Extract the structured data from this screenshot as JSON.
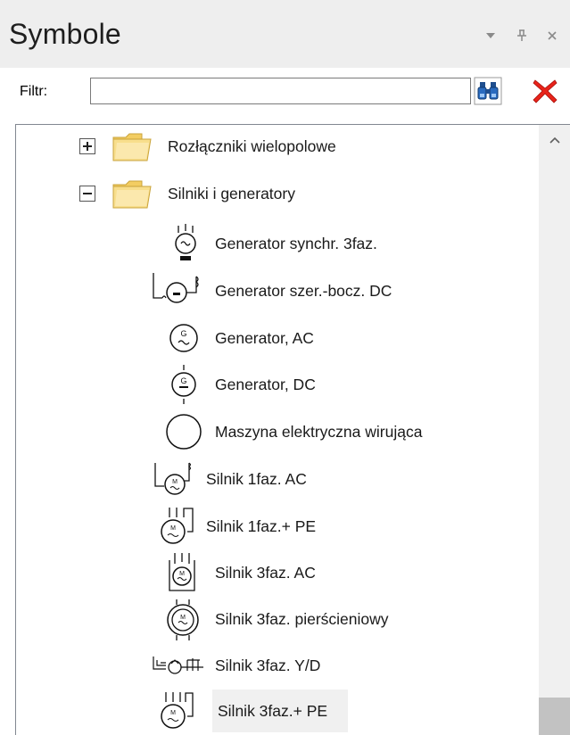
{
  "panel": {
    "title": "Symbole",
    "dropdown_icon": "▼",
    "pin_icon": "ᛰ",
    "close_icon": "×"
  },
  "filter": {
    "label": "Filtr:",
    "value": "",
    "placeholder": "",
    "search_icon": "binoculars-icon",
    "clear_icon": "red-x-icon"
  },
  "tree": {
    "folders": [
      {
        "label": "Rozłączniki wielopolowe",
        "expanded": false
      },
      {
        "label": "Silniki i generatory",
        "expanded": true
      }
    ],
    "items": [
      {
        "label": "Generator synchr. 3faz.",
        "icon": "generator-synchronous-icon"
      },
      {
        "label": "Generator szer.-bocz. DC",
        "icon": "generator-compound-dc-icon"
      },
      {
        "label": "Generator, AC",
        "icon": "generator-ac-icon"
      },
      {
        "label": "Generator, DC",
        "icon": "generator-dc-icon"
      },
      {
        "label": "Maszyna elektryczna wirująca",
        "icon": "rotating-machine-icon"
      },
      {
        "label": "Silnik 1faz. AC",
        "icon": "motor-1phase-ac-icon"
      },
      {
        "label": "Silnik 1faz.+ PE",
        "icon": "motor-1phase-pe-icon"
      },
      {
        "label": "Silnik 3faz. AC",
        "icon": "motor-3phase-ac-icon"
      },
      {
        "label": "Silnik 3faz. pierścieniowy",
        "icon": "motor-slip-ring-icon"
      },
      {
        "label": "Silnik 3faz. Y/D",
        "icon": "motor-star-delta-icon"
      },
      {
        "label": "Silnik 3faz.+ PE",
        "icon": "motor-3phase-pe-icon",
        "hovered": true
      }
    ]
  },
  "colors": {
    "folder": "#f6d77c",
    "folder_edge": "#c9a33b",
    "clear_red": "#e8231a",
    "search_blue": "#1f6fc5"
  }
}
